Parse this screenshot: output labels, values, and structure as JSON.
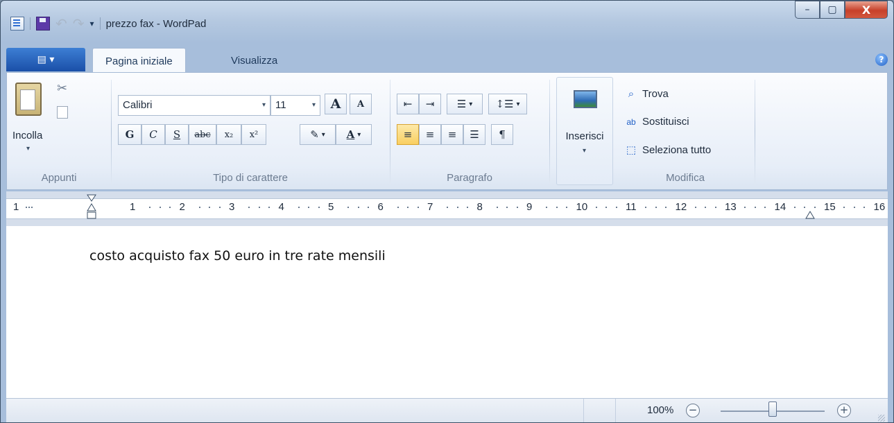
{
  "window": {
    "title": "prezzo fax - WordPad",
    "controls": {
      "minimize": "–",
      "maximize": "▢",
      "close": "X"
    }
  },
  "quick_access": {
    "icons": [
      "wordpad-app-icon",
      "save-icon",
      "undo-icon",
      "redo-icon",
      "customize-dropdown-icon"
    ],
    "dropdown_glyph": "▾"
  },
  "ribbon": {
    "app_menu_label": "▤ ▾",
    "tabs": [
      {
        "label": "Pagina iniziale",
        "active": true
      },
      {
        "label": "Visualizza",
        "active": false
      }
    ],
    "help_glyph": "?",
    "groups": {
      "clipboard": {
        "label": "Appunti",
        "paste_label": "Incolla"
      },
      "font": {
        "label": "Tipo di carattere",
        "font_family": "Calibri",
        "font_size": "11",
        "grow": "A",
        "shrink": "A",
        "bold": "G",
        "italic": "C",
        "underline": "S",
        "strike": "abc",
        "subscript": "x₂",
        "superscript": "x²",
        "text_color": "A"
      },
      "paragraph": {
        "label": "Paragrafo",
        "active_alignment": "left"
      },
      "insert": {
        "label": "Inserisci"
      },
      "editing": {
        "label": "Modifica",
        "find": "Trova",
        "replace": "Sostituisci",
        "select_all": "Seleziona tutto"
      }
    }
  },
  "ruler": {
    "labels": [
      "1",
      "1",
      "2",
      "3",
      "4",
      "5",
      "6",
      "7",
      "8",
      "9",
      "10",
      "11",
      "12",
      "13",
      "14",
      "15",
      "16"
    ]
  },
  "document": {
    "text": "costo acquisto fax 50 euro in tre rate mensili"
  },
  "status_bar": {
    "zoom": "100%",
    "zoom_out": "−",
    "zoom_in": "+",
    "zoom_fraction": 0.5
  },
  "colors": {
    "accent": "#1f5fc6",
    "title_bar": "#c9d9ec",
    "active_button": "#f9cf61",
    "close_button": "#c7402a"
  }
}
